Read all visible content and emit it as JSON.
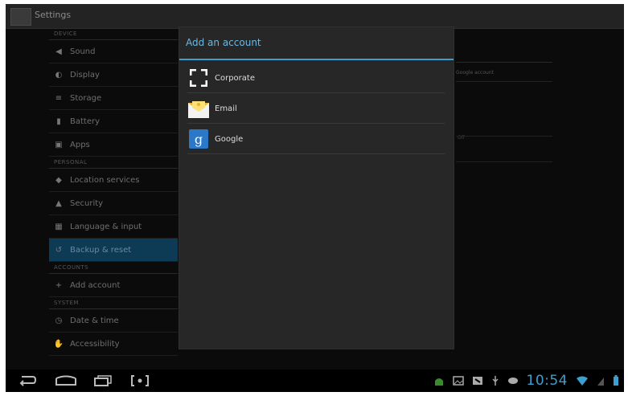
{
  "app": {
    "title": "Settings"
  },
  "sidebar": {
    "sections": [
      {
        "header": "DEVICE",
        "items": [
          {
            "label": "Sound",
            "icon": "speaker-icon"
          },
          {
            "label": "Display",
            "icon": "brightness-icon"
          },
          {
            "label": "Storage",
            "icon": "storage-icon"
          },
          {
            "label": "Battery",
            "icon": "battery-icon"
          },
          {
            "label": "Apps",
            "icon": "apps-icon"
          }
        ]
      },
      {
        "header": "PERSONAL",
        "items": [
          {
            "label": "Location services",
            "icon": "location-icon"
          },
          {
            "label": "Security",
            "icon": "lock-icon"
          },
          {
            "label": "Language & input",
            "icon": "keyboard-icon"
          },
          {
            "label": "Backup & reset",
            "icon": "backup-icon",
            "active": true
          }
        ]
      },
      {
        "header": "ACCOUNTS",
        "items": [
          {
            "label": "Add account",
            "icon": "plus-icon"
          }
        ]
      },
      {
        "header": "SYSTEM",
        "items": [
          {
            "label": "Date & time",
            "icon": "clock-icon"
          },
          {
            "label": "Accessibility",
            "icon": "accessibility-icon"
          }
        ]
      }
    ]
  },
  "background_panel": {
    "text1": "Google account",
    "text2": "Off"
  },
  "dialog": {
    "title": "Add an account",
    "options": [
      {
        "label": "Corporate",
        "icon": "corporate-icon"
      },
      {
        "label": "Email",
        "icon": "email-icon"
      },
      {
        "label": "Google",
        "icon": "google-icon"
      }
    ]
  },
  "navbar": {
    "time": "10:54"
  },
  "colors": {
    "accent": "#3aa0d0",
    "dialog_bg": "#272727",
    "active_item": "#0d3a55"
  }
}
